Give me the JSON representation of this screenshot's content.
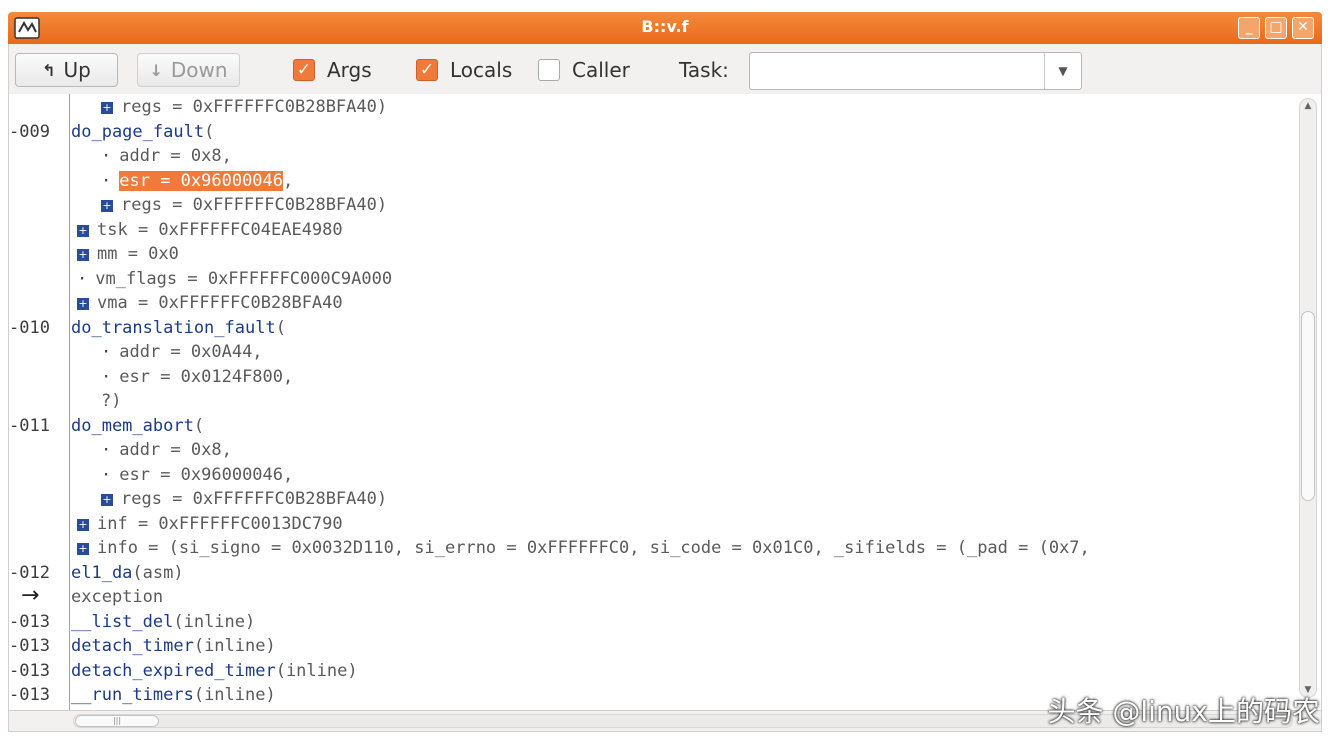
{
  "window": {
    "title": "B::v.f",
    "controls": [
      "_",
      "□",
      "✕"
    ]
  },
  "toolbar": {
    "up_label": "Up",
    "down_label": "Down",
    "args_label": "Args",
    "args_checked": true,
    "locals_label": "Locals",
    "locals_checked": true,
    "caller_label": "Caller",
    "caller_checked": false,
    "task_label": "Task:",
    "task_value": ""
  },
  "accent_color": "#f07a3a",
  "stack": {
    "rows": [
      {
        "level": "",
        "indent": 2,
        "marker": "plus",
        "text": "regs = 0xFFFFFFC0B28BFA40)"
      },
      {
        "level": "-009",
        "indent": 0,
        "marker": "",
        "fn": "do_page_fault",
        "text": "("
      },
      {
        "level": "",
        "indent": 2,
        "marker": "dot",
        "text": "addr = 0x8,"
      },
      {
        "level": "",
        "indent": 2,
        "marker": "dot",
        "highlight": "esr = 0x96000046",
        "text": ","
      },
      {
        "level": "",
        "indent": 2,
        "marker": "plus",
        "text": "regs = 0xFFFFFFC0B28BFA40)"
      },
      {
        "level": "",
        "indent": 1,
        "marker": "plus",
        "text": "tsk = 0xFFFFFFC04EAE4980"
      },
      {
        "level": "",
        "indent": 1,
        "marker": "plus",
        "text": "mm = 0x0"
      },
      {
        "level": "",
        "indent": 1,
        "marker": "dot",
        "text": "vm_flags = 0xFFFFFFC000C9A000"
      },
      {
        "level": "",
        "indent": 1,
        "marker": "plus",
        "text": "vma = 0xFFFFFFC0B28BFA40"
      },
      {
        "level": "-010",
        "indent": 0,
        "marker": "",
        "fn": "do_translation_fault",
        "text": "("
      },
      {
        "level": "",
        "indent": 2,
        "marker": "dot",
        "text": "addr = 0x0A44,"
      },
      {
        "level": "",
        "indent": 2,
        "marker": "dot",
        "text": "esr = 0x0124F800,"
      },
      {
        "level": "",
        "indent": 2,
        "marker": "",
        "text": "?)"
      },
      {
        "level": "-011",
        "indent": 0,
        "marker": "",
        "fn": "do_mem_abort",
        "text": "("
      },
      {
        "level": "",
        "indent": 2,
        "marker": "dot",
        "text": "addr = 0x8,"
      },
      {
        "level": "",
        "indent": 2,
        "marker": "dot",
        "text": "esr = 0x96000046,"
      },
      {
        "level": "",
        "indent": 2,
        "marker": "plus",
        "text": "regs = 0xFFFFFFC0B28BFA40)"
      },
      {
        "level": "",
        "indent": 1,
        "marker": "plus",
        "text": "inf = 0xFFFFFFC0013DC790"
      },
      {
        "level": "",
        "indent": 1,
        "marker": "plus",
        "text": "info = (si_signo = 0x0032D110, si_errno = 0xFFFFFFC0, si_code = 0x01C0, _sifields = (_pad = (0x7,"
      },
      {
        "level": "-012",
        "indent": 0,
        "marker": "",
        "fn": "el1_da",
        "text": "(asm)"
      },
      {
        "level": "→",
        "indent": 0,
        "marker": "",
        "text": "exception"
      },
      {
        "level": "-013",
        "indent": 0,
        "marker": "",
        "fn": "__list_del",
        "text": "(inline)"
      },
      {
        "level": "-013",
        "indent": 0,
        "marker": "",
        "fn": "detach_timer",
        "text": "(inline)"
      },
      {
        "level": "-013",
        "indent": 0,
        "marker": "",
        "fn": "detach_expired_timer",
        "text": "(inline)"
      },
      {
        "level": "-013",
        "indent": 0,
        "marker": "",
        "fn": "__run_timers",
        "text": "(inline)"
      }
    ]
  },
  "watermark": "头条 @linux上的码农"
}
